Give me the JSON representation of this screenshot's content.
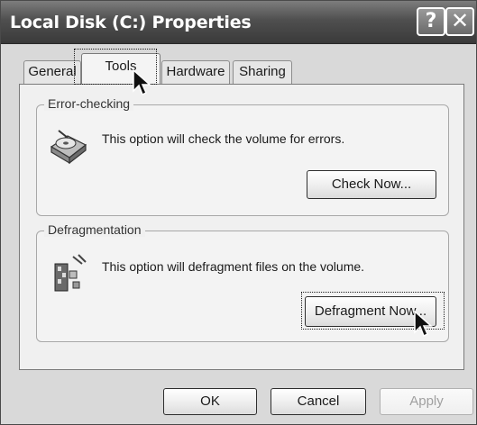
{
  "window": {
    "title": "Local Disk (C:) Properties",
    "help_glyph": "?",
    "close_glyph": "✕"
  },
  "tabs": [
    {
      "label": "General",
      "selected": false
    },
    {
      "label": "Tools",
      "selected": true
    },
    {
      "label": "Hardware",
      "selected": false
    },
    {
      "label": "Sharing",
      "selected": false
    }
  ],
  "error_checking": {
    "group_label": "Error-checking",
    "description": "This option will check the volume for errors.",
    "icon": "disk-check-icon",
    "button_label": "Check Now..."
  },
  "defragmentation": {
    "group_label": "Defragmentation",
    "description": "This option will defragment files on the volume.",
    "icon": "defragment-icon",
    "button_label": "Defragment Now..."
  },
  "footer": {
    "ok_label": "OK",
    "cancel_label": "Cancel",
    "apply_label": "Apply",
    "apply_enabled": false
  },
  "colors": {
    "titlebar": "#4f4f4f",
    "dialog_bg": "#d9d9d9",
    "panel_bg": "#f0f0f0"
  }
}
